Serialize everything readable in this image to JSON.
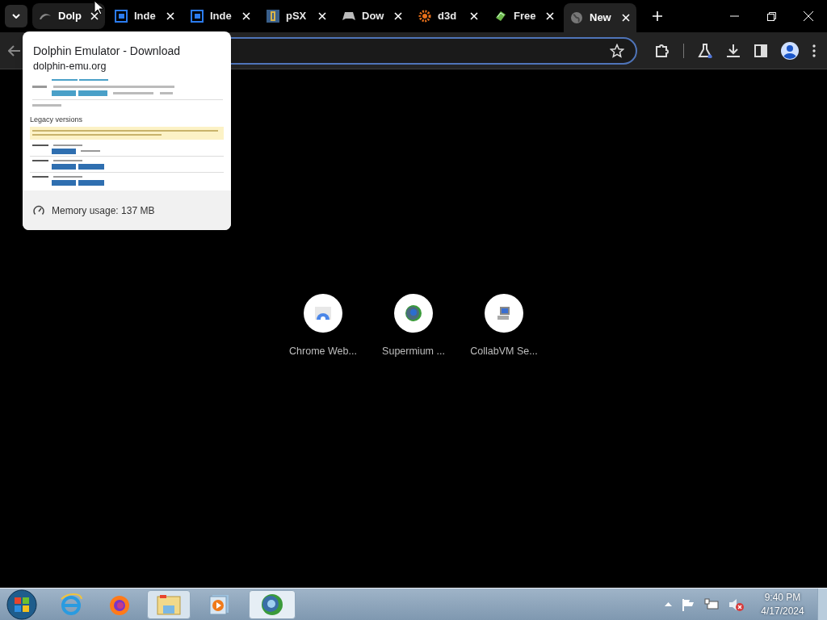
{
  "tabs": [
    {
      "label": "Dolp",
      "selected": false,
      "hovered": true
    },
    {
      "label": "Inde",
      "selected": false,
      "hovered": false
    },
    {
      "label": "Inde",
      "selected": false,
      "hovered": false
    },
    {
      "label": "pSX",
      "selected": false,
      "hovered": false
    },
    {
      "label": "Dow",
      "selected": false,
      "hovered": false
    },
    {
      "label": "d3d",
      "selected": false,
      "hovered": false
    },
    {
      "label": "Free",
      "selected": false,
      "hovered": false
    },
    {
      "label": "New",
      "selected": true,
      "hovered": false
    }
  ],
  "hover_card": {
    "title": "Dolphin Emulator - Download",
    "domain": "dolphin-emu.org",
    "preview_heading": "Legacy versions",
    "memory": "Memory usage: 137 MB"
  },
  "shortcuts": [
    {
      "label": "Chrome Web..."
    },
    {
      "label": "Supermium ..."
    },
    {
      "label": "CollabVM Se..."
    }
  ],
  "taskbar": {
    "time": "9:40 PM",
    "date": "4/17/2024"
  }
}
